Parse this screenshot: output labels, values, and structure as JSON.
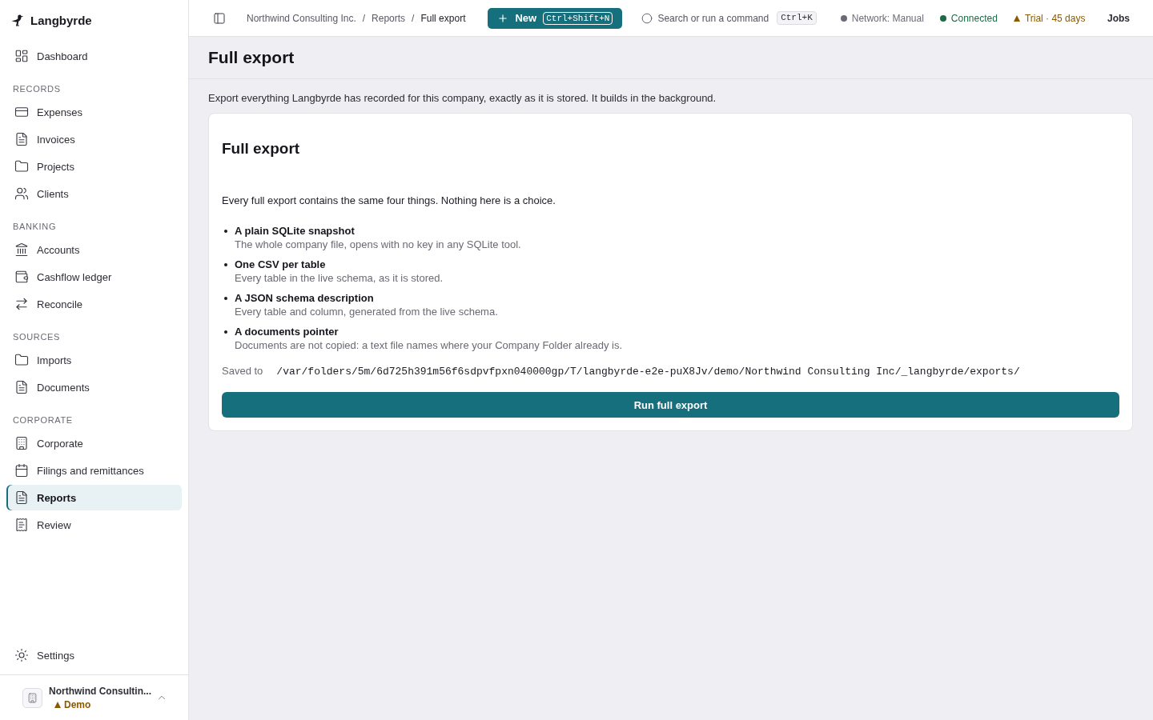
{
  "sidebar": {
    "brand": "Langbyrde",
    "groups": [
      {
        "items": [
          {
            "label": "Dashboard",
            "selected": false
          }
        ]
      },
      {
        "heading": "RECORDS",
        "items": [
          {
            "label": "Expenses",
            "selected": false
          },
          {
            "label": "Invoices",
            "selected": false
          },
          {
            "label": "Projects",
            "selected": false
          },
          {
            "label": "Clients",
            "selected": false
          }
        ]
      },
      {
        "heading": "BANKING",
        "items": [
          {
            "label": "Accounts",
            "selected": false
          },
          {
            "label": "Cashflow ledger",
            "selected": false
          },
          {
            "label": "Reconcile",
            "selected": false
          }
        ]
      },
      {
        "heading": "SOURCES",
        "items": [
          {
            "label": "Imports",
            "selected": false
          },
          {
            "label": "Documents",
            "selected": false
          }
        ]
      },
      {
        "heading": "CORPORATE",
        "items": [
          {
            "label": "Corporate",
            "selected": false
          },
          {
            "label": "Filings and remittances",
            "selected": false
          },
          {
            "label": "Reports",
            "selected": true
          },
          {
            "label": "Review",
            "selected": false
          }
        ]
      }
    ],
    "footer_items": [
      {
        "label": "Settings",
        "selected": false
      }
    ],
    "company": {
      "name": "Northwind Consultin...",
      "badge": "Demo"
    }
  },
  "topbar": {
    "breadcrumb": [
      {
        "label": "Northwind Consulting Inc.",
        "separator": "/",
        "current": false
      },
      {
        "label": "Reports",
        "separator": "/",
        "current": false
      },
      {
        "label": "Full export",
        "current": true
      }
    ],
    "new_button": {
      "label": "New",
      "shortcut": "Ctrl+Shift+N"
    },
    "search": {
      "label": "Search or run a command",
      "shortcut": "Ctrl+K"
    },
    "statuses": [
      {
        "kind": "dot",
        "label": "Network: Manual",
        "color": "#6b6a75"
      },
      {
        "kind": "dot",
        "label": "Connected",
        "color": "#1e6a47"
      },
      {
        "kind": "triangle",
        "label": "Trial · 45 days",
        "color": "#8a5a00"
      }
    ],
    "jobs_button": "Jobs"
  },
  "page": {
    "title": "Full export",
    "description": "Export everything Langbyrde has recorded for this company, exactly as it is stored. It builds in the background."
  },
  "card": {
    "title": "Full export",
    "intro": "Every full export contains the same four things. Nothing here is a choice.",
    "items": [
      {
        "title": "A plain SQLite snapshot",
        "description": "The whole company file, opens with no key in any SQLite tool."
      },
      {
        "title": "One CSV per table",
        "description": "Every table in the live schema, as it is stored."
      },
      {
        "title": "A JSON schema description",
        "description": "Every table and column, generated from the live schema."
      },
      {
        "title": "A documents pointer",
        "description": "Documents are not copied: a text file names where your Company Folder already is."
      }
    ],
    "saved_to": {
      "label": "Saved to",
      "path": "/var/folders/5m/6d725h391m56f6sdpvfpxn040000gp/T/langbyrde-e2e-puX8Jv/demo/Northwind Consulting Inc/_langbyrde/exports/"
    },
    "button": "Run full export"
  }
}
